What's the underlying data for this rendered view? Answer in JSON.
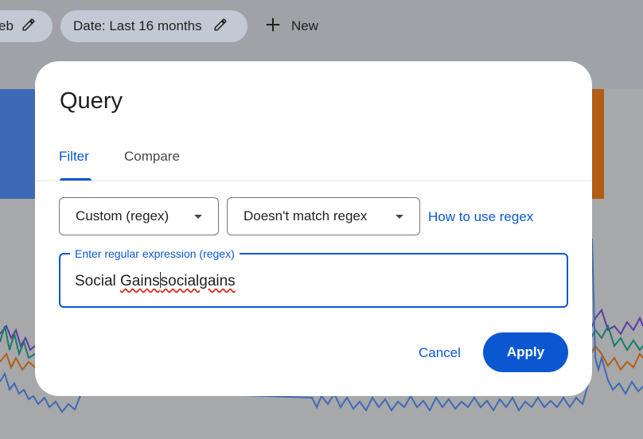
{
  "background": {
    "chips": [
      {
        "label": "eb"
      },
      {
        "label": "Date: Last 16 months"
      }
    ],
    "new_button": {
      "label": "New"
    },
    "chart_colors": {
      "blue": "#3e6ab5",
      "purple": "#5d3aa6",
      "teal": "#197a68",
      "orange": "#b25d14"
    }
  },
  "dialog": {
    "title": "Query",
    "tabs": [
      {
        "label": "Filter",
        "active": true
      },
      {
        "label": "Compare",
        "active": false
      }
    ],
    "filter_type_select": {
      "value": "Custom (regex)"
    },
    "match_select": {
      "value": "Doesn't match regex"
    },
    "help_link": "How to use regex",
    "regex_field": {
      "label": "Enter regular expression (regex)",
      "value_part1": "Social ",
      "value_part2": "Gains",
      "value_part3": "socialgains"
    },
    "cancel_label": "Cancel",
    "apply_label": "Apply"
  }
}
